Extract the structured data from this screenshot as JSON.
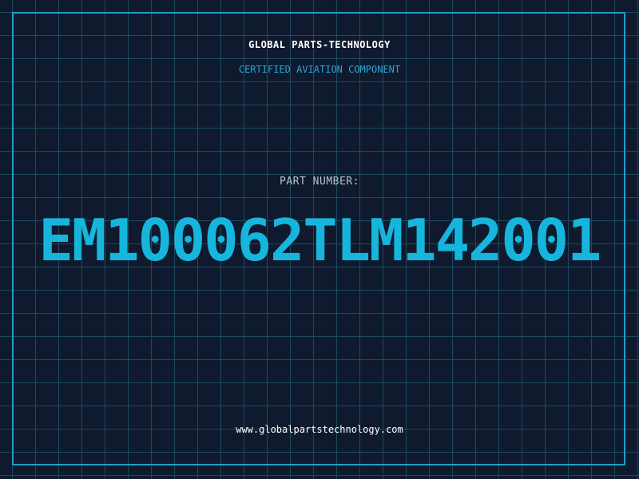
{
  "header": {
    "company": "GLOBAL PARTS-TECHNOLOGY",
    "subtitle": "CERTIFIED AVIATION COMPONENT"
  },
  "part": {
    "label": "PART NUMBER:",
    "number": "EM100062TLM142001"
  },
  "footer": {
    "url": "www.globalpartstechnology.com"
  },
  "colors": {
    "background": "#0f1a2e",
    "grid": "#1d4a5e",
    "accent": "#16b6dc",
    "border": "#1c9fc9",
    "text": "#ffffff"
  }
}
